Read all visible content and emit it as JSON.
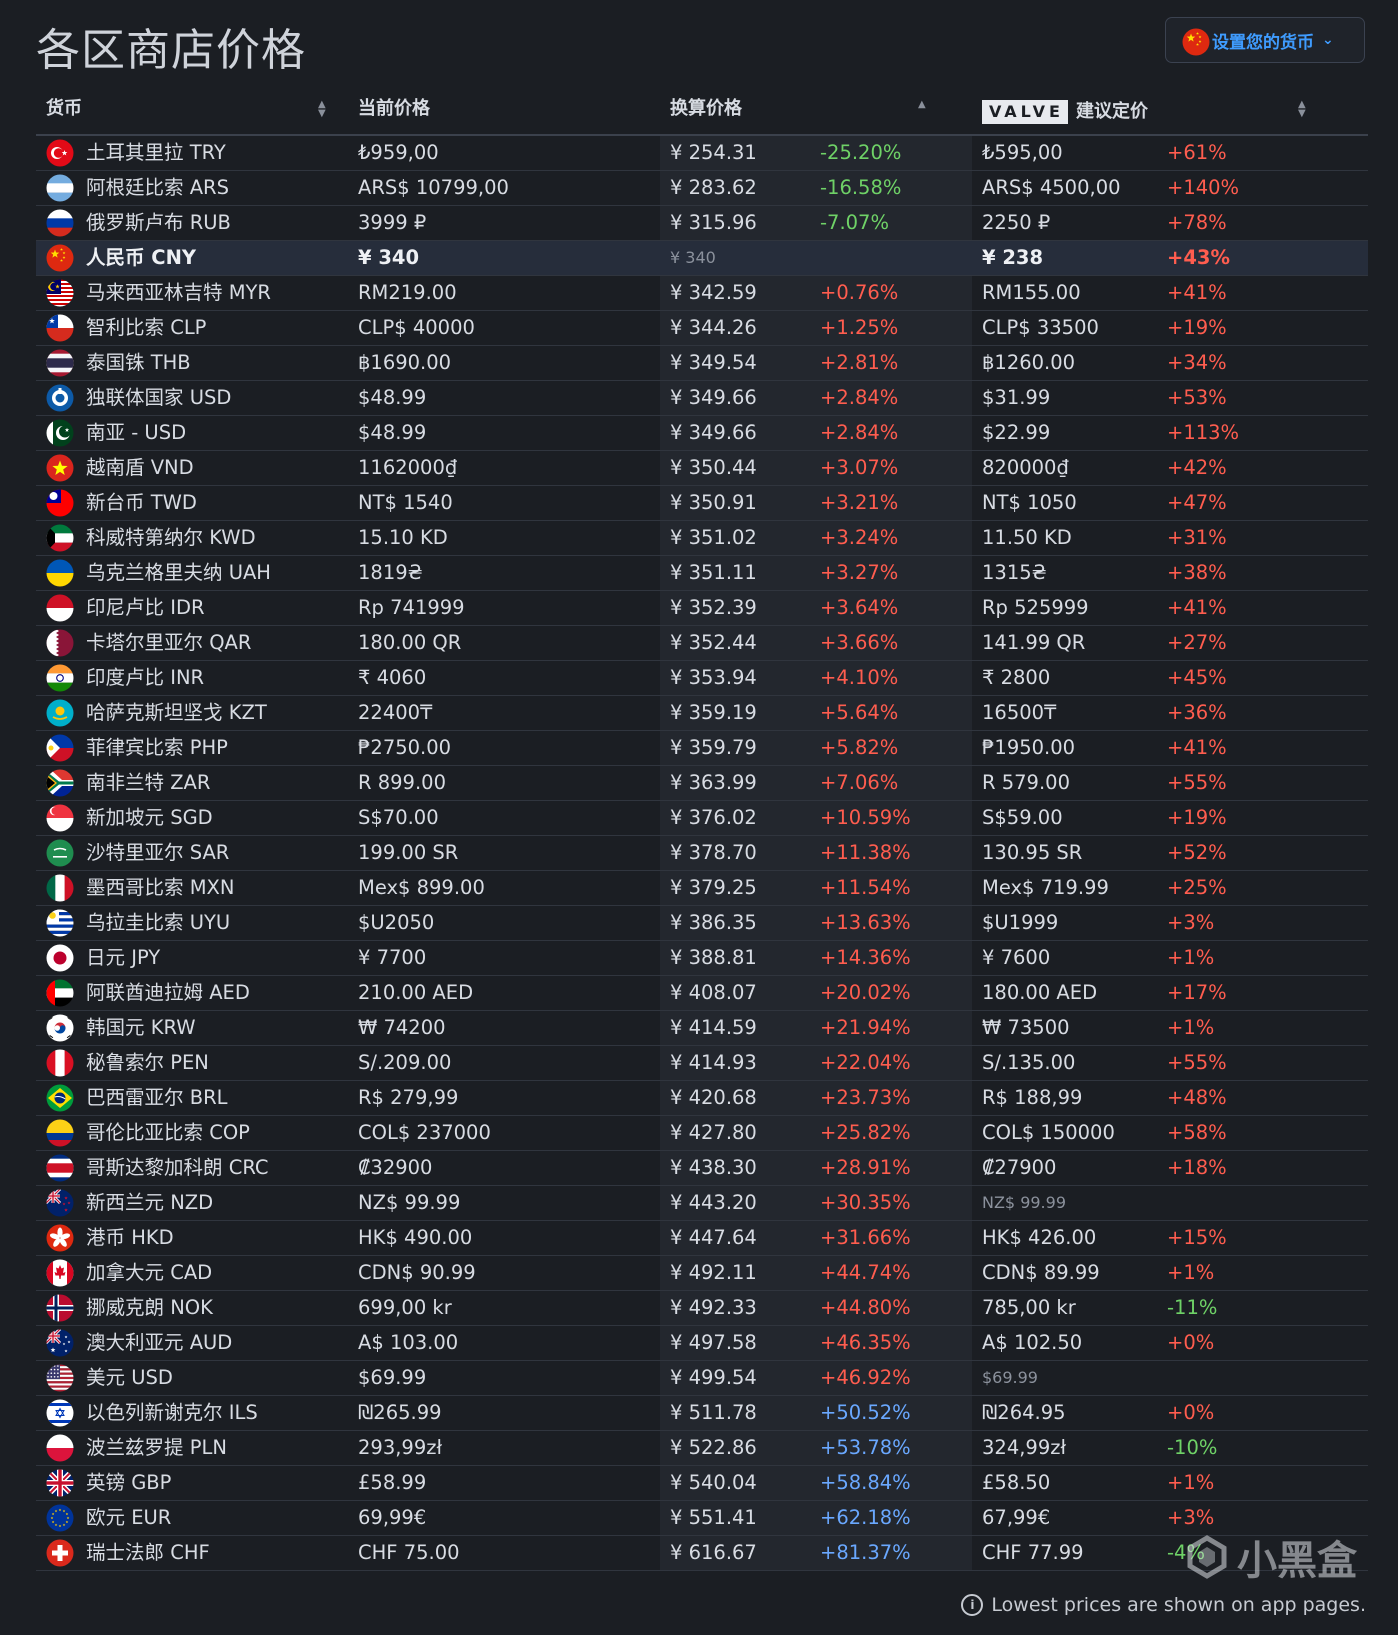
{
  "title": "各区商店价格",
  "currency_button": {
    "label": "设置您的货币",
    "flag": "cn"
  },
  "columns": {
    "currency": "货币",
    "current_price": "当前价格",
    "converted_price": "换算价格",
    "valve_badge": "VALVE",
    "valve_price": "建议定价"
  },
  "colors": {
    "accent": "#3f9cff",
    "up": "#ff5d4f",
    "down": "#6fd267",
    "highlight_row": "#262d3b"
  },
  "rows": [
    {
      "flag": "tr",
      "name": "土耳其里拉 TRY",
      "price": "₺959,00",
      "conv": "¥ 254.31",
      "diff": "-25.20%",
      "diff_color": "green",
      "valve": "₺595,00",
      "vdiff": "+61%",
      "vdiff_color": "red"
    },
    {
      "flag": "ar",
      "name": "阿根廷比索 ARS",
      "price": "ARS$ 10799,00",
      "conv": "¥ 283.62",
      "diff": "-16.58%",
      "diff_color": "green",
      "valve": "ARS$ 4500,00",
      "vdiff": "+140%",
      "vdiff_color": "red"
    },
    {
      "flag": "ru",
      "name": "俄罗斯卢布 RUB",
      "price": "3999 ₽",
      "conv": "¥ 315.96",
      "diff": "-7.07%",
      "diff_color": "green",
      "valve": "2250 ₽",
      "vdiff": "+78%",
      "vdiff_color": "red"
    },
    {
      "flag": "cn",
      "name": "人民币 CNY",
      "price": "¥ 340",
      "conv": "¥ 340",
      "diff": "",
      "diff_color": "none",
      "valve": "¥ 238",
      "vdiff": "+43%",
      "vdiff_color": "red",
      "highlight": true
    },
    {
      "flag": "my",
      "name": "马来西亚林吉特 MYR",
      "price": "RM219.00",
      "conv": "¥ 342.59",
      "diff": "+0.76%",
      "diff_color": "red",
      "valve": "RM155.00",
      "vdiff": "+41%",
      "vdiff_color": "red"
    },
    {
      "flag": "cl",
      "name": "智利比索 CLP",
      "price": "CLP$ 40000",
      "conv": "¥ 344.26",
      "diff": "+1.25%",
      "diff_color": "red",
      "valve": "CLP$ 33500",
      "vdiff": "+19%",
      "vdiff_color": "red"
    },
    {
      "flag": "th",
      "name": "泰国铢 THB",
      "price": "฿1690.00",
      "conv": "¥ 349.54",
      "diff": "+2.81%",
      "diff_color": "red",
      "valve": "฿1260.00",
      "vdiff": "+34%",
      "vdiff_color": "red"
    },
    {
      "flag": "cis",
      "name": "独联体国家 USD",
      "price": "$48.99",
      "conv": "¥ 349.66",
      "diff": "+2.84%",
      "diff_color": "red",
      "valve": "$31.99",
      "vdiff": "+53%",
      "vdiff_color": "red"
    },
    {
      "flag": "pk",
      "name": "南亚 - USD",
      "price": "$48.99",
      "conv": "¥ 349.66",
      "diff": "+2.84%",
      "diff_color": "red",
      "valve": "$22.99",
      "vdiff": "+113%",
      "vdiff_color": "red"
    },
    {
      "flag": "vn",
      "name": "越南盾 VND",
      "price": "1162000₫",
      "conv": "¥ 350.44",
      "diff": "+3.07%",
      "diff_color": "red",
      "valve": "820000₫",
      "vdiff": "+42%",
      "vdiff_color": "red"
    },
    {
      "flag": "tw",
      "name": "新台币 TWD",
      "price": "NT$ 1540",
      "conv": "¥ 350.91",
      "diff": "+3.21%",
      "diff_color": "red",
      "valve": "NT$ 1050",
      "vdiff": "+47%",
      "vdiff_color": "red"
    },
    {
      "flag": "kw",
      "name": "科威特第纳尔 KWD",
      "price": "15.10 KD",
      "conv": "¥ 351.02",
      "diff": "+3.24%",
      "diff_color": "red",
      "valve": "11.50 KD",
      "vdiff": "+31%",
      "vdiff_color": "red"
    },
    {
      "flag": "ua",
      "name": "乌克兰格里夫纳 UAH",
      "price": "1819₴",
      "conv": "¥ 351.11",
      "diff": "+3.27%",
      "diff_color": "red",
      "valve": "1315₴",
      "vdiff": "+38%",
      "vdiff_color": "red"
    },
    {
      "flag": "id",
      "name": "印尼卢比 IDR",
      "price": "Rp 741999",
      "conv": "¥ 352.39",
      "diff": "+3.64%",
      "diff_color": "red",
      "valve": "Rp 525999",
      "vdiff": "+41%",
      "vdiff_color": "red"
    },
    {
      "flag": "qa",
      "name": "卡塔尔里亚尔 QAR",
      "price": "180.00 QR",
      "conv": "¥ 352.44",
      "diff": "+3.66%",
      "diff_color": "red",
      "valve": "141.99 QR",
      "vdiff": "+27%",
      "vdiff_color": "red"
    },
    {
      "flag": "in",
      "name": "印度卢比 INR",
      "price": "₹ 4060",
      "conv": "¥ 353.94",
      "diff": "+4.10%",
      "diff_color": "red",
      "valve": "₹ 2800",
      "vdiff": "+45%",
      "vdiff_color": "red"
    },
    {
      "flag": "kz",
      "name": "哈萨克斯坦坚戈 KZT",
      "price": "22400₸",
      "conv": "¥ 359.19",
      "diff": "+5.64%",
      "diff_color": "red",
      "valve": "16500₸",
      "vdiff": "+36%",
      "vdiff_color": "red"
    },
    {
      "flag": "ph",
      "name": "菲律宾比索 PHP",
      "price": "₱2750.00",
      "conv": "¥ 359.79",
      "diff": "+5.82%",
      "diff_color": "red",
      "valve": "₱1950.00",
      "vdiff": "+41%",
      "vdiff_color": "red"
    },
    {
      "flag": "za",
      "name": "南非兰特 ZAR",
      "price": "R 899.00",
      "conv": "¥ 363.99",
      "diff": "+7.06%",
      "diff_color": "red",
      "valve": "R 579.00",
      "vdiff": "+55%",
      "vdiff_color": "red"
    },
    {
      "flag": "sg",
      "name": "新加坡元 SGD",
      "price": "S$70.00",
      "conv": "¥ 376.02",
      "diff": "+10.59%",
      "diff_color": "red",
      "valve": "S$59.00",
      "vdiff": "+19%",
      "vdiff_color": "red"
    },
    {
      "flag": "sa",
      "name": "沙特里亚尔 SAR",
      "price": "199.00 SR",
      "conv": "¥ 378.70",
      "diff": "+11.38%",
      "diff_color": "red",
      "valve": "130.95 SR",
      "vdiff": "+52%",
      "vdiff_color": "red"
    },
    {
      "flag": "mx",
      "name": "墨西哥比索 MXN",
      "price": "Mex$ 899.00",
      "conv": "¥ 379.25",
      "diff": "+11.54%",
      "diff_color": "red",
      "valve": "Mex$ 719.99",
      "vdiff": "+25%",
      "vdiff_color": "red"
    },
    {
      "flag": "uy",
      "name": "乌拉圭比索 UYU",
      "price": "$U2050",
      "conv": "¥ 386.35",
      "diff": "+13.63%",
      "diff_color": "red",
      "valve": "$U1999",
      "vdiff": "+3%",
      "vdiff_color": "red"
    },
    {
      "flag": "jp",
      "name": "日元 JPY",
      "price": "¥ 7700",
      "conv": "¥ 388.81",
      "diff": "+14.36%",
      "diff_color": "red",
      "valve": "¥ 7600",
      "vdiff": "+1%",
      "vdiff_color": "red"
    },
    {
      "flag": "ae",
      "name": "阿联酋迪拉姆 AED",
      "price": "210.00 AED",
      "conv": "¥ 408.07",
      "diff": "+20.02%",
      "diff_color": "red",
      "valve": "180.00 AED",
      "vdiff": "+17%",
      "vdiff_color": "red"
    },
    {
      "flag": "kr",
      "name": "韩国元 KRW",
      "price": "₩ 74200",
      "conv": "¥ 414.59",
      "diff": "+21.94%",
      "diff_color": "red",
      "valve": "₩ 73500",
      "vdiff": "+1%",
      "vdiff_color": "red"
    },
    {
      "flag": "pe",
      "name": "秘鲁索尔 PEN",
      "price": "S/.209.00",
      "conv": "¥ 414.93",
      "diff": "+22.04%",
      "diff_color": "red",
      "valve": "S/.135.00",
      "vdiff": "+55%",
      "vdiff_color": "red"
    },
    {
      "flag": "br",
      "name": "巴西雷亚尔 BRL",
      "price": "R$ 279,99",
      "conv": "¥ 420.68",
      "diff": "+23.73%",
      "diff_color": "red",
      "valve": "R$ 188,99",
      "vdiff": "+48%",
      "vdiff_color": "red"
    },
    {
      "flag": "co",
      "name": "哥伦比亚比索 COP",
      "price": "COL$ 237000",
      "conv": "¥ 427.80",
      "diff": "+25.82%",
      "diff_color": "red",
      "valve": "COL$ 150000",
      "vdiff": "+58%",
      "vdiff_color": "red"
    },
    {
      "flag": "cr",
      "name": "哥斯达黎加科朗 CRC",
      "price": "₡32900",
      "conv": "¥ 438.30",
      "diff": "+28.91%",
      "diff_color": "red",
      "valve": "₡27900",
      "vdiff": "+18%",
      "vdiff_color": "red"
    },
    {
      "flag": "nz",
      "name": "新西兰元 NZD",
      "price": "NZ$ 99.99",
      "conv": "¥ 443.20",
      "diff": "+30.35%",
      "diff_color": "red",
      "valve": "NZ$ 99.99",
      "valve_dim": true,
      "vdiff": "",
      "vdiff_color": "none"
    },
    {
      "flag": "hk",
      "name": "港币 HKD",
      "price": "HK$ 490.00",
      "conv": "¥ 447.64",
      "diff": "+31.66%",
      "diff_color": "red",
      "valve": "HK$ 426.00",
      "vdiff": "+15%",
      "vdiff_color": "red"
    },
    {
      "flag": "ca",
      "name": "加拿大元 CAD",
      "price": "CDN$ 90.99",
      "conv": "¥ 492.11",
      "diff": "+44.74%",
      "diff_color": "red",
      "valve": "CDN$ 89.99",
      "vdiff": "+1%",
      "vdiff_color": "red"
    },
    {
      "flag": "no",
      "name": "挪威克朗 NOK",
      "price": "699,00 kr",
      "conv": "¥ 492.33",
      "diff": "+44.80%",
      "diff_color": "red",
      "valve": "785,00 kr",
      "vdiff": "-11%",
      "vdiff_color": "green"
    },
    {
      "flag": "au",
      "name": "澳大利亚元 AUD",
      "price": "A$ 103.00",
      "conv": "¥ 497.58",
      "diff": "+46.35%",
      "diff_color": "red",
      "valve": "A$ 102.50",
      "vdiff": "+0%",
      "vdiff_color": "red"
    },
    {
      "flag": "us",
      "name": "美元 USD",
      "price": "$69.99",
      "conv": "¥ 499.54",
      "diff": "+46.92%",
      "diff_color": "red",
      "valve": "$69.99",
      "valve_dim": true,
      "vdiff": "",
      "vdiff_color": "none"
    },
    {
      "flag": "il",
      "name": "以色列新谢克尔 ILS",
      "price": "₪265.99",
      "conv": "¥ 511.78",
      "diff": "+50.52%",
      "diff_color": "blue",
      "valve": "₪264.95",
      "vdiff": "+0%",
      "vdiff_color": "red"
    },
    {
      "flag": "pl",
      "name": "波兰兹罗提 PLN",
      "price": "293,99zł",
      "conv": "¥ 522.86",
      "diff": "+53.78%",
      "diff_color": "blue",
      "valve": "324,99zł",
      "vdiff": "-10%",
      "vdiff_color": "green"
    },
    {
      "flag": "gb",
      "name": "英镑 GBP",
      "price": "£58.99",
      "conv": "¥ 540.04",
      "diff": "+58.84%",
      "diff_color": "blue",
      "valve": "£58.50",
      "vdiff": "+1%",
      "vdiff_color": "red"
    },
    {
      "flag": "eu",
      "name": "欧元 EUR",
      "price": "69,99€",
      "conv": "¥ 551.41",
      "diff": "+62.18%",
      "diff_color": "blue",
      "valve": "67,99€",
      "vdiff": "+3%",
      "vdiff_color": "red"
    },
    {
      "flag": "ch",
      "name": "瑞士法郎 CHF",
      "price": "CHF 75.00",
      "conv": "¥ 616.67",
      "diff": "+81.37%",
      "diff_color": "blue",
      "valve": "CHF 77.99",
      "vdiff": "-4%",
      "vdiff_color": "green"
    }
  ],
  "footer": {
    "info_glyph": "i",
    "text": "Lowest prices are shown on app pages."
  },
  "watermark": {
    "text": "小黑盒"
  }
}
